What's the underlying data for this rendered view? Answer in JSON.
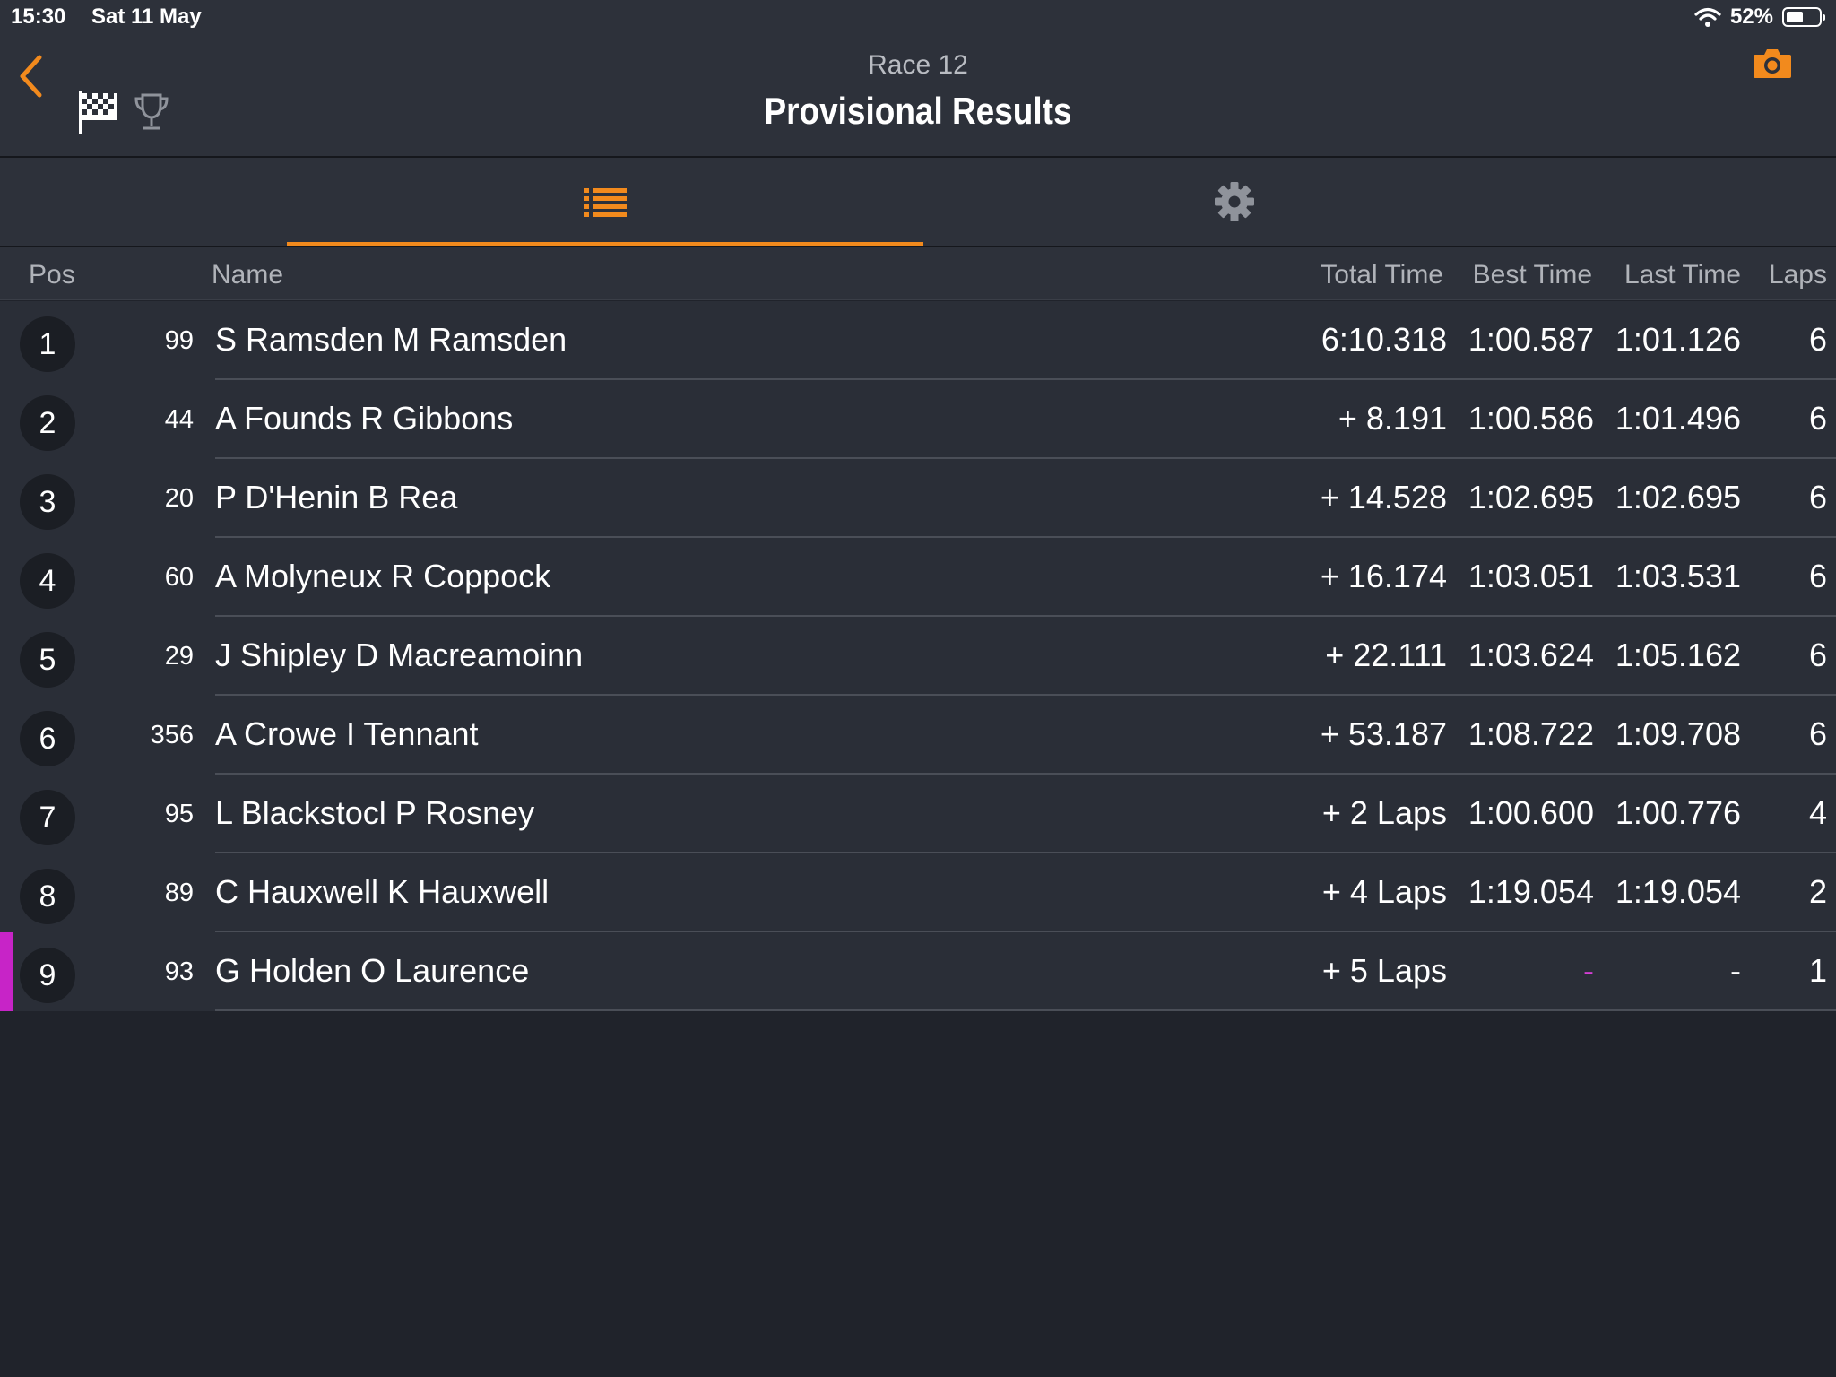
{
  "status_bar": {
    "time": "15:30",
    "date": "Sat 11 May",
    "battery": "52%",
    "battery_level": 0.52
  },
  "header": {
    "subtitle": "Race 12",
    "title": "Provisional Results"
  },
  "colors": {
    "accent": "#f28a1d",
    "background": "#20232b",
    "panel": "#2d313a",
    "row": "#2a2e37",
    "highlight": "#c724c7"
  },
  "icons": {
    "back": "chevron-left-icon",
    "flag": "checkered-flag-icon",
    "trophy": "trophy-icon",
    "camera": "camera-icon",
    "list": "list-icon",
    "settings": "gear-icon"
  },
  "columns": {
    "pos": "Pos",
    "name": "Name",
    "total": "Total Time",
    "best": "Best Time",
    "last": "Last Time",
    "laps": "Laps"
  },
  "rows": [
    {
      "pos": "1",
      "number": "99",
      "name": "S Ramsden M Ramsden",
      "total": "6:10.318",
      "best": "1:00.587",
      "last": "1:01.126",
      "laps": "6"
    },
    {
      "pos": "2",
      "number": "44",
      "name": "A Founds R Gibbons",
      "total": "+ 8.191",
      "best": "1:00.586",
      "last": "1:01.496",
      "laps": "6"
    },
    {
      "pos": "3",
      "number": "20",
      "name": "P D'Henin B Rea",
      "total": "+ 14.528",
      "best": "1:02.695",
      "last": "1:02.695",
      "laps": "6"
    },
    {
      "pos": "4",
      "number": "60",
      "name": "A Molyneux R Coppock",
      "total": "+ 16.174",
      "best": "1:03.051",
      "last": "1:03.531",
      "laps": "6"
    },
    {
      "pos": "5",
      "number": "29",
      "name": "J Shipley D Macreamoinn",
      "total": "+ 22.111",
      "best": "1:03.624",
      "last": "1:05.162",
      "laps": "6"
    },
    {
      "pos": "6",
      "number": "356",
      "name": "A Crowe I Tennant",
      "total": "+ 53.187",
      "best": "1:08.722",
      "last": "1:09.708",
      "laps": "6"
    },
    {
      "pos": "7",
      "number": "95",
      "name": "L Blackstocl P Rosney",
      "total": "+ 2 Laps",
      "best": "1:00.600",
      "last": "1:00.776",
      "laps": "4"
    },
    {
      "pos": "8",
      "number": "89",
      "name": "C Hauxwell K Hauxwell",
      "total": "+ 4 Laps",
      "best": "1:19.054",
      "last": "1:19.054",
      "laps": "2"
    },
    {
      "pos": "9",
      "number": "93",
      "name": "G Holden O Laurence",
      "total": "+ 5 Laps",
      "best": "-",
      "last": "-",
      "laps": "1",
      "highlight": true
    }
  ]
}
